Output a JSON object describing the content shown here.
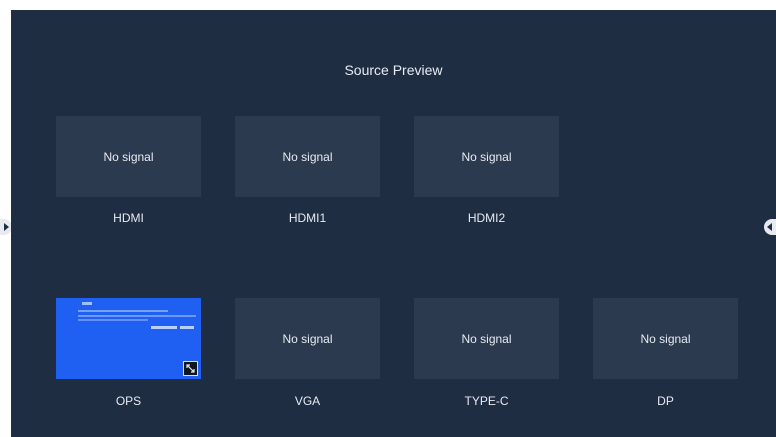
{
  "title": "Source Preview",
  "no_signal": "No signal",
  "sources": {
    "hdmi": "HDMI",
    "hdmi1": "HDMI1",
    "hdmi2": "HDMI2",
    "ops": "OPS",
    "vga": "VGA",
    "typec": "TYPE-C",
    "dp": "DP"
  },
  "icons": {
    "left_arrow": "arrow-left-icon",
    "right_arrow": "arrow-right-icon",
    "expand": "expand-icon"
  },
  "colors": {
    "background": "#1f2d42",
    "tile": "#2c3a4f",
    "ops_preview": "#1f5ff2",
    "text": "#e6ebf2"
  }
}
